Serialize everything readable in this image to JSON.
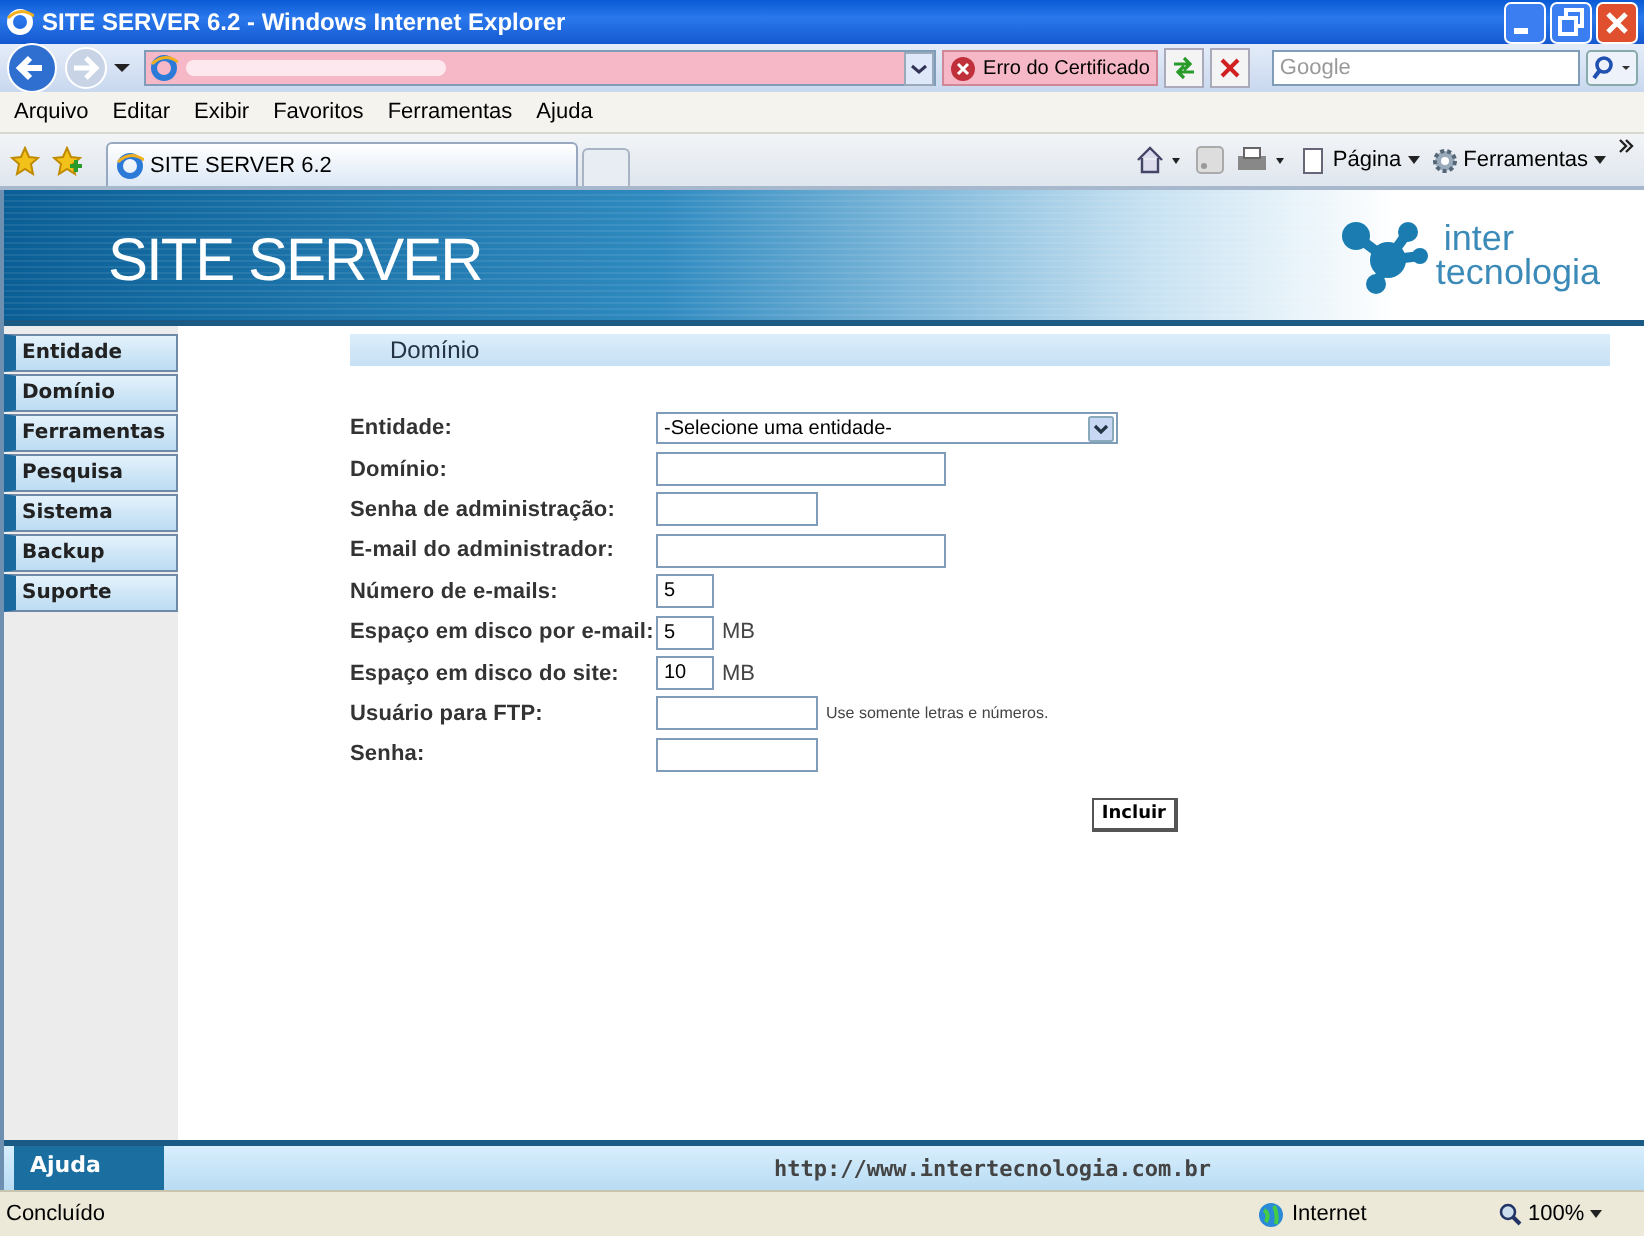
{
  "window": {
    "title": "SITE SERVER 6.2 - Windows Internet Explorer"
  },
  "navigation": {
    "certificate_error": "Erro do Certificado",
    "search": {
      "placeholder": "Google"
    }
  },
  "menu": [
    "Arquivo",
    "Editar",
    "Exibir",
    "Favoritos",
    "Ferramentas",
    "Ajuda"
  ],
  "tab": {
    "label": "SITE SERVER 6.2"
  },
  "commands": [
    "Página",
    "Ferramentas"
  ],
  "banner": {
    "title": "SITE SERVER",
    "logo_lines": [
      "inter",
      "tecnologia"
    ]
  },
  "sidebar": {
    "items": [
      "Entidade",
      "Domínio",
      "Ferramentas",
      "Pesquisa",
      "Sistema",
      "Backup",
      "Suporte"
    ]
  },
  "section_title": "Domínio",
  "form": [
    {
      "label": "Entidade:",
      "kind": "select",
      "value": "-Selecione uma entidade-"
    },
    {
      "label": "Domínio:",
      "kind": "long"
    },
    {
      "label": "Senha de administração:",
      "kind": "short"
    },
    {
      "label": "E-mail do administrador:",
      "kind": "long"
    },
    {
      "label": "Número de e-mails:",
      "kind": "number",
      "value": "5"
    },
    {
      "label": "Espaço em disco por e-mail:",
      "kind": "number",
      "value": "5",
      "unit": "MB"
    },
    {
      "label": "Espaço em disco do site:",
      "kind": "number",
      "value": "10",
      "unit": "MB"
    },
    {
      "label": "Usuário para FTP:",
      "kind": "short",
      "hint": "Use somente letras e números."
    },
    {
      "label": "Senha:",
      "kind": "short"
    }
  ],
  "submit": "Incluir",
  "footer": {
    "help": "Ajuda",
    "url": "http://www.intertecnologia.com.br"
  },
  "status_bar": {
    "text": "Concluído",
    "zone": "Internet",
    "zoom": "100%"
  }
}
